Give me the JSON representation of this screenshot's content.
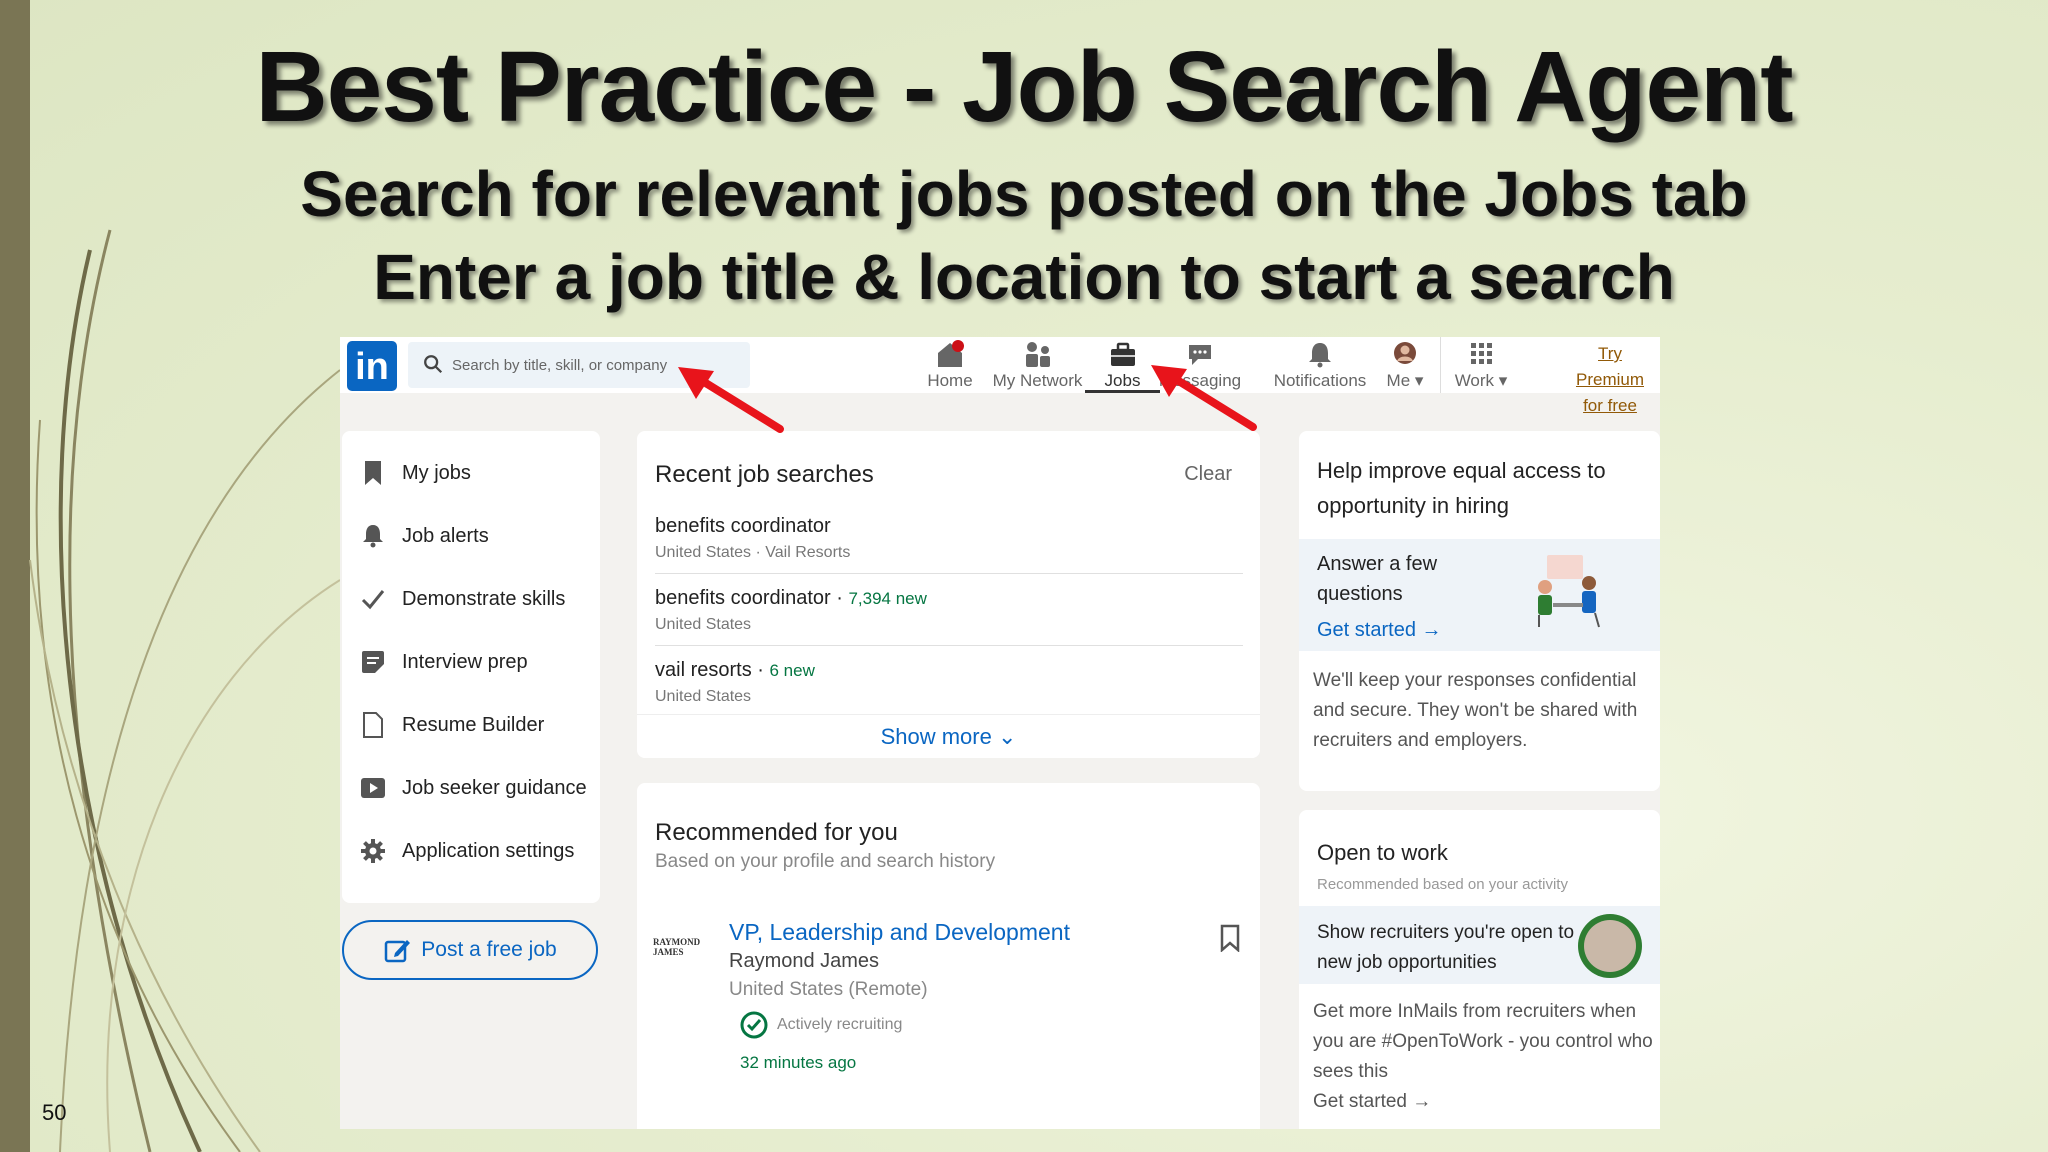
{
  "slide": {
    "title": "Best Practice - Job Search Agent",
    "subtitle_line1": "Search for relevant jobs posted on the Jobs tab",
    "subtitle_line2": "Enter a job title & location to start a search",
    "page_number": "50"
  },
  "linkedin": {
    "logo": "in",
    "search_placeholder": "Search by title, skill, or company",
    "nav": [
      {
        "label": "Home",
        "icon": "home-icon"
      },
      {
        "label": "My Network",
        "icon": "network-icon"
      },
      {
        "label": "Jobs",
        "icon": "briefcase-icon",
        "active": true
      },
      {
        "label": "Messaging",
        "icon": "message-icon"
      },
      {
        "label": "Notifications",
        "icon": "bell-icon"
      },
      {
        "label": "Me",
        "icon": "avatar"
      },
      {
        "label": "Work",
        "icon": "grid-icon"
      }
    ],
    "premium_line1": "Try Premium",
    "premium_line2": "for free",
    "left_nav": [
      {
        "label": "My jobs",
        "icon": "bookmark-icon"
      },
      {
        "label": "Job alerts",
        "icon": "bell-icon"
      },
      {
        "label": "Demonstrate skills",
        "icon": "checkmark-icon"
      },
      {
        "label": "Interview prep",
        "icon": "clipboard-icon"
      },
      {
        "label": "Resume Builder",
        "icon": "document-icon"
      },
      {
        "label": "Job seeker guidance",
        "icon": "play-icon"
      },
      {
        "label": "Application settings",
        "icon": "gear-icon"
      }
    ],
    "post_job": "Post a free job",
    "recent": {
      "title": "Recent job searches",
      "clear": "Clear",
      "items": [
        {
          "title": "benefits coordinator",
          "new": "",
          "sub": "United States · Vail Resorts"
        },
        {
          "title": "benefits coordinator",
          "new": "7,394 new",
          "sub": "United States"
        },
        {
          "title": "vail resorts",
          "new": "6 new",
          "sub": "United States"
        }
      ],
      "show_more": "Show more"
    },
    "recommended": {
      "title": "Recommended for you",
      "subtitle": "Based on your profile and search history",
      "company_logo_text": "RAYMOND JAMES",
      "job_title": "VP, Leadership and Development",
      "company": "Raymond James",
      "location": "United States (Remote)",
      "status": "Actively recruiting",
      "posted": "32 minutes ago"
    },
    "help": {
      "title": "Help improve equal access to opportunity in hiring",
      "answer": "Answer a few questions",
      "cta": "Get started",
      "body": "We'll keep your responses confidential and secure. They won't be shared with recruiters and employers."
    },
    "open_to_work": {
      "title": "Open to work",
      "subtitle": "Recommended based on your activity",
      "show": "Show recruiters you're open to new job opportunities",
      "body": "Get more InMails from recruiters when you are #OpenToWork - you control who sees this",
      "cta": "Get started"
    }
  },
  "colors": {
    "linkedin_blue": "#0a66c2",
    "new_green": "#057642",
    "arrow_red": "#e8141b",
    "notification_red": "#cc1016"
  }
}
